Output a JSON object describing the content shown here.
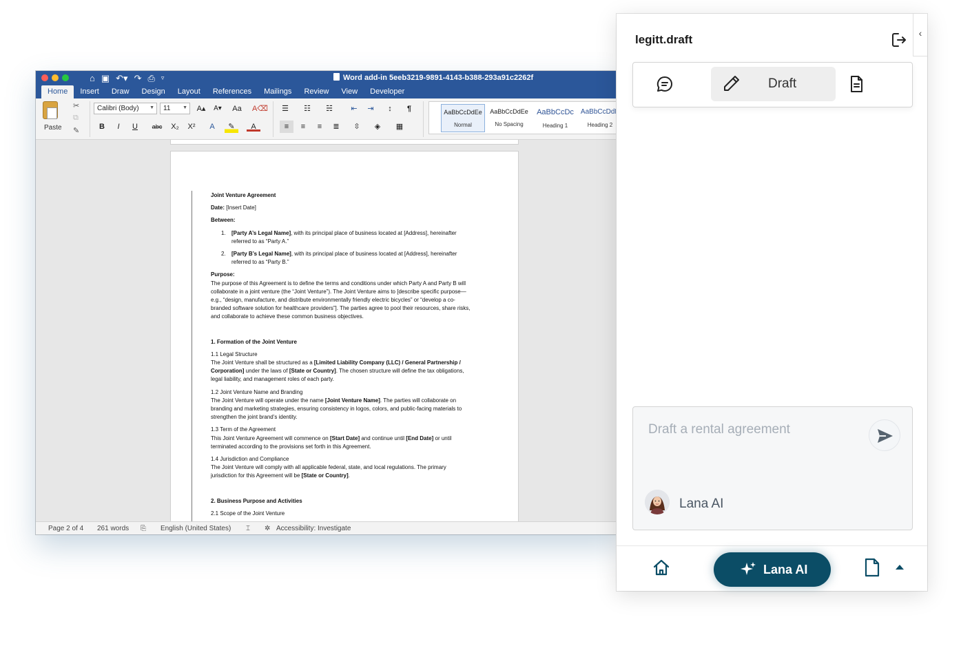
{
  "word": {
    "window_title": "Word add-in 5eeb3219-9891-4143-b388-293a91c2262f",
    "tabs": [
      "Home",
      "Insert",
      "Draw",
      "Design",
      "Layout",
      "References",
      "Mailings",
      "Review",
      "View",
      "Developer"
    ],
    "active_tab": "Home",
    "ribbon": {
      "paste_label": "Paste",
      "font_name": "Calibri (Body)",
      "font_size": "11",
      "styles": [
        {
          "sample": "AaBbCcDdEe",
          "name": "Normal"
        },
        {
          "sample": "AaBbCcDdEe",
          "name": "No Spacing"
        },
        {
          "sample": "AaBbCcDc",
          "name": "Heading 1"
        },
        {
          "sample": "AaBbCcDdE",
          "name": "Heading 2"
        }
      ]
    },
    "document": {
      "title": "Joint Venture Agreement",
      "date_label": "Date:",
      "date_value": "[Insert Date]",
      "between": "Between:",
      "parties": [
        {
          "num": "1.",
          "name": "[Party A’s Legal Name]",
          "text": ", with its principal place of business located at [Address], hereinafter referred to as “Party A.”"
        },
        {
          "num": "2.",
          "name": "[Party B’s Legal Name]",
          "text": ", with its principal place of business located at [Address], hereinafter referred to as “Party B.”"
        }
      ],
      "purpose_heading": "Purpose:",
      "purpose_text": "The purpose of this Agreement is to define the terms and conditions under which Party A and Party B will collaborate in a joint venture (the “Joint Venture”). The Joint Venture aims to [describe specific purpose—e.g., “design, manufacture, and distribute environmentally friendly electric bicycles” or “develop a co-branded software solution for healthcare providers”]. The parties agree to pool their resources, share risks, and collaborate to achieve these common business objectives.",
      "section1": "1. Formation of the Joint Venture",
      "s11_title": "1.1 Legal Structure",
      "s11_a": "The Joint Venture shall be structured as a ",
      "s11_b": "[Limited Liability Company (LLC) / General Partnership / Corporation]",
      "s11_c": " under the laws of ",
      "s11_d": "[State or Country]",
      "s11_e": ". The chosen structure will define the tax obligations, legal liability, and management roles of each party.",
      "s12_title": "1.2 Joint Venture Name and Branding",
      "s12_a": "The Joint Venture will operate under the name ",
      "s12_b": "[Joint Venture Name]",
      "s12_c": ". The parties will collaborate on branding and marketing strategies, ensuring consistency in logos, colors, and public-facing materials to strengthen the joint brand’s identity.",
      "s13_title": "1.3 Term of the Agreement",
      "s13_a": "This Joint Venture Agreement will commence on ",
      "s13_b": "[Start Date]",
      "s13_c": " and continue until ",
      "s13_d": "[End Date]",
      "s13_e": " or until terminated according to the provisions set forth in this Agreement.",
      "s14_title": "1.4 Jurisdiction and Compliance",
      "s14_a": "The Joint Venture will comply with all applicable federal, state, and local regulations. The primary jurisdiction for this Agreement will be ",
      "s14_b": "[State or Country]",
      "s14_c": ".",
      "section2": "2. Business Purpose and Activities",
      "s21_title": "2.1 Scope of the Joint Venture"
    },
    "status": {
      "page": "Page 2 of 4",
      "words": "261 words",
      "language": "English (United States)",
      "accessibility": "Accessibility: Investigate"
    }
  },
  "panel": {
    "title": "legitt.draft",
    "modes": {
      "chat_icon": "chat-bubble-icon",
      "draft_icon": "pencil-icon",
      "draft_label": "Draft",
      "document_icon": "document-icon"
    },
    "prompt_placeholder": "Draft a rental agreement",
    "agent_name": "Lana AI",
    "footer": {
      "home_icon": "home-icon",
      "cta_label": "Lana AI",
      "doc_icon": "file-icon",
      "caret_icon": "caret-up-icon"
    },
    "colors": {
      "accent": "#0b4d66",
      "word_blue": "#2b579a"
    }
  }
}
